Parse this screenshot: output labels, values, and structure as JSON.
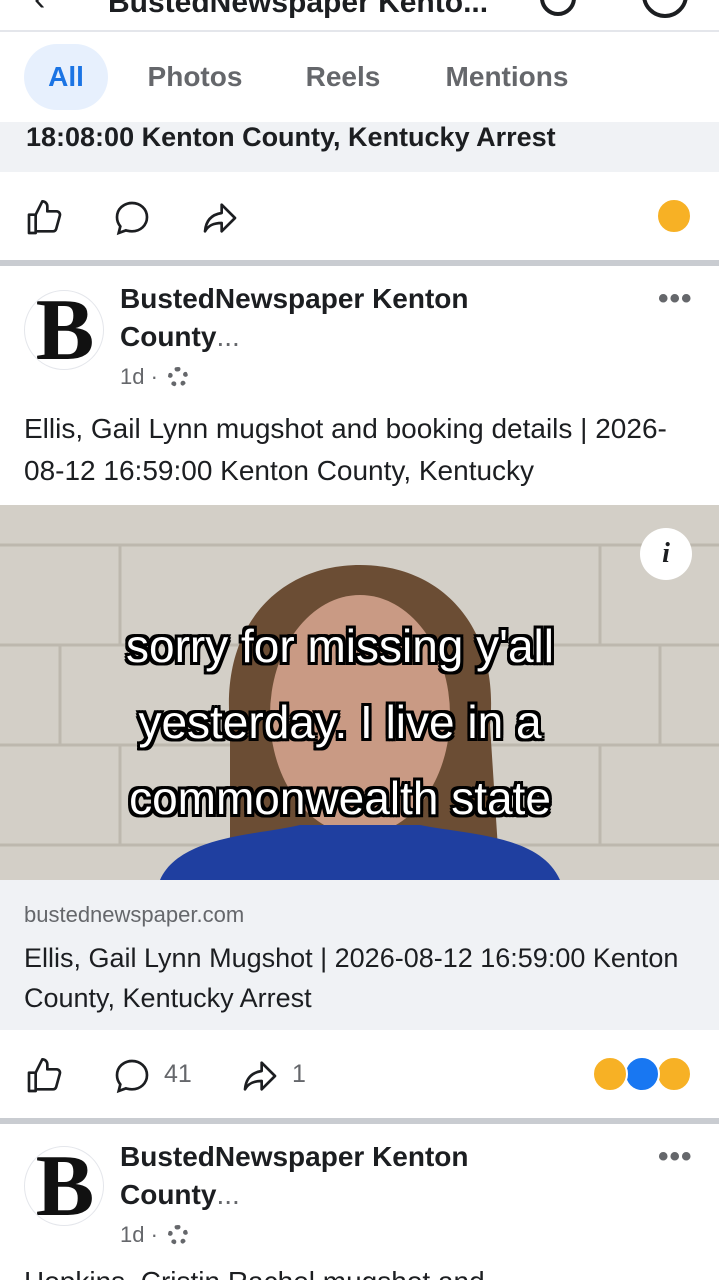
{
  "header": {
    "title": "BustedNewspaper Kento...",
    "back_icon": "back-arrow-icon",
    "search_icon": "search-icon"
  },
  "tabs": [
    {
      "label": "All",
      "active": true
    },
    {
      "label": "Photos",
      "active": false
    },
    {
      "label": "Reels",
      "active": false
    },
    {
      "label": "Mentions",
      "active": false
    }
  ],
  "previous_post": {
    "link_title_tail": "18:08:00 Kenton County, Kentucky Arrest"
  },
  "post": {
    "page_name": "BustedNewspaper Kenton County...",
    "page_name_line1": "BustedNewspaper Kenton",
    "page_name_line2": "County",
    "ellipsis": "...",
    "time": "1d ·",
    "text": "Ellis, Gail Lynn mugshot and booking details | 2026-08-12 16:59:00 Kenton County, Kentucky",
    "image_overlay_text": "sorry for missing y'all yesterday. I live in a commonwealth state",
    "info_glyph": "i",
    "link_domain": "bustednewspaper.com",
    "link_title": "Ellis, Gail Lynn Mugshot | 2026-08-12 16:59:00 Kenton County, Kentucky Arrest",
    "comments_count": "41",
    "shares_count": "1"
  },
  "next_post": {
    "page_name_line1": "BustedNewspaper Kenton",
    "page_name_line2": "County",
    "ellipsis": "...",
    "time": "1d ·",
    "text_tail": "Hopkins, Cristin Rachel mugshot and"
  },
  "logo_letter": "B",
  "more_glyph": "•••",
  "colors": {
    "accent": "#1b74e4",
    "tab_active_bg": "#e7f0fd",
    "link_bg": "#f0f2f5",
    "secondary_text": "#65676b"
  }
}
